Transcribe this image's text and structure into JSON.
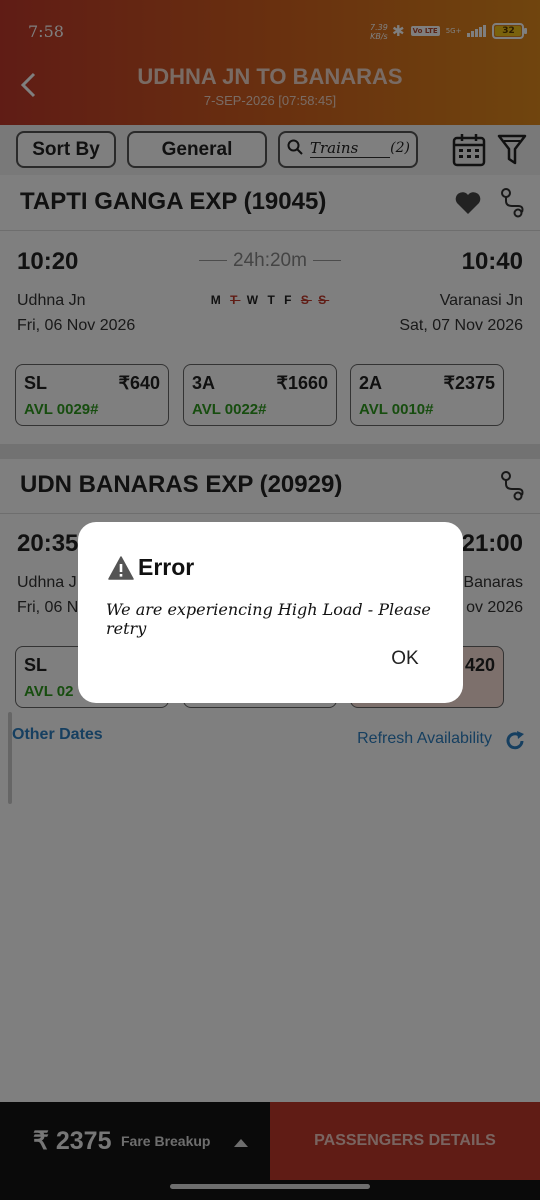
{
  "status_bar": {
    "time": "7:58",
    "net_speed_value": "7.39",
    "net_speed_unit": "KB/s",
    "vo_badge": "Vo LTE",
    "network": "5G+",
    "battery": "32"
  },
  "header": {
    "title": "UDHNA JN TO BANARAS",
    "subtitle": "7-SEP-2026 [07:58:45]"
  },
  "filters": {
    "sort_label": "Sort By",
    "quota_label": "General",
    "search_text": "Trains",
    "search_count": "(2)"
  },
  "trains": [
    {
      "name": "TAPTI GANGA EXP (19045)",
      "departure": "10:20",
      "arrival": "10:40",
      "duration": "24h:20m",
      "from_station": "Udhna Jn",
      "to_station": "Varanasi Jn",
      "from_date": "Fri, 06 Nov 2026",
      "to_date": "Sat, 07 Nov 2026",
      "days": [
        "M",
        "T",
        "W",
        "T",
        "F",
        "S",
        "S"
      ],
      "classes": [
        {
          "name": "SL",
          "fare": "₹640",
          "availability": "AVL 0029#"
        },
        {
          "name": "3A",
          "fare": "₹1660",
          "availability": "AVL 0022#"
        },
        {
          "name": "2A",
          "fare": "₹2375",
          "availability": "AVL 0010#"
        }
      ]
    },
    {
      "name": "UDN BANARAS EXP (20929)",
      "departure": "20:35",
      "arrival": "21:00",
      "from_station": "Udhna J",
      "to_station": "Banaras",
      "from_date": "Fri, 06 N",
      "to_date": "ov 2026",
      "classes": [
        {
          "name": "SL",
          "fare": "",
          "availability": "AVL 02"
        },
        {
          "name": "",
          "fare": "",
          "availability": ""
        },
        {
          "name": "",
          "fare": "420",
          "availability": ""
        }
      ]
    }
  ],
  "links": {
    "other_dates": "Other Dates",
    "refresh": "Refresh Availability"
  },
  "bottom": {
    "fare": "₹ 2375",
    "fare_breakup": "Fare Breakup",
    "passengers_button": "PASSENGERS DETAILS"
  },
  "dialog": {
    "title": "Error",
    "message": "We are experiencing High Load - Please retry",
    "ok": "OK"
  },
  "colors": {
    "header_start": "#c0392b",
    "header_end": "#e08a1c",
    "avl_green": "#2e9a1f",
    "link_blue": "#2d7fc1",
    "cta_red": "#c0392b"
  }
}
